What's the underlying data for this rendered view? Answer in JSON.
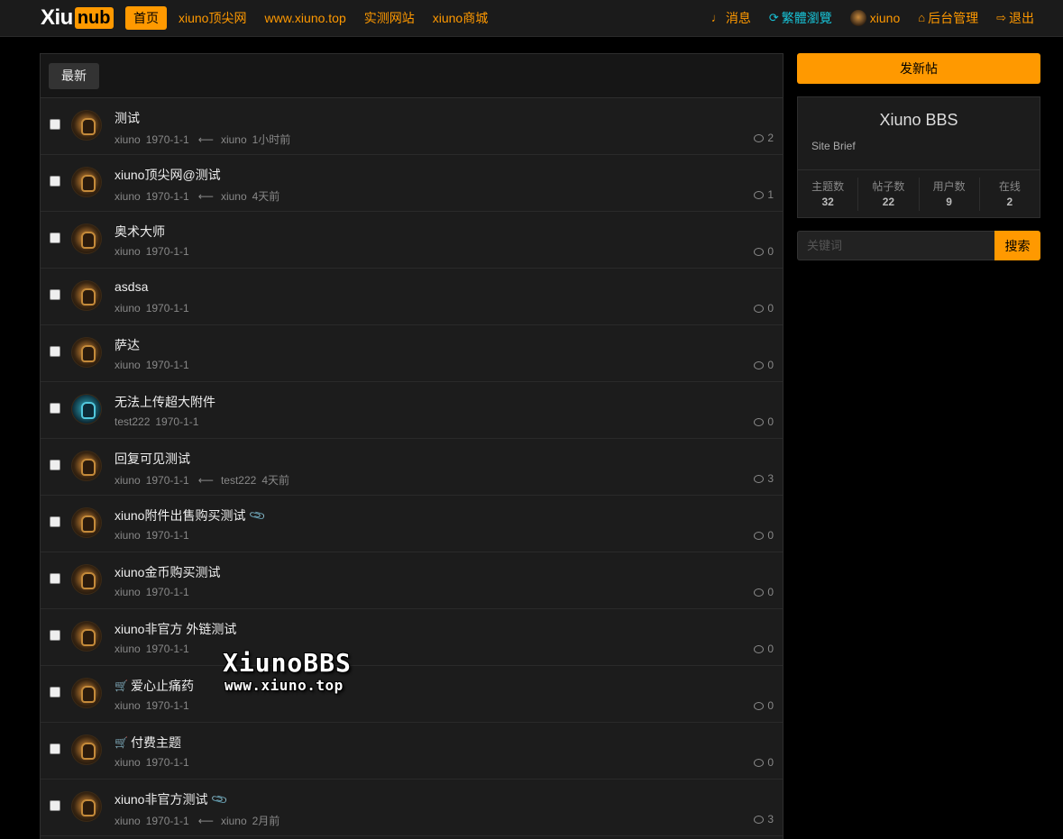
{
  "logo": {
    "part1": "Xiu",
    "part2": "nub"
  },
  "nav": {
    "left": [
      "首页",
      "xiuno顶尖网",
      "www.xiuno.top",
      "实测网站",
      "xiuno商城"
    ],
    "right": [
      {
        "icon": "bell-icon",
        "glyph": "🔔",
        "label": "消息"
      },
      {
        "icon": "refresh-icon",
        "glyph": "⟳",
        "label": "繁體瀏覽"
      },
      {
        "icon": "user-avatar",
        "glyph": "",
        "label": "xiuno"
      },
      {
        "icon": "home-icon",
        "glyph": "⌂",
        "label": "后台管理"
      },
      {
        "icon": "logout-icon",
        "glyph": "⇥",
        "label": "退出"
      }
    ]
  },
  "tabs": {
    "latest": "最新"
  },
  "threads": [
    {
      "title": "测试",
      "author": "xiuno",
      "date": "1970-1-1",
      "last_user": "xiuno",
      "last_time": "1小时前",
      "replies": "2",
      "avatar": "orange",
      "prefix": "",
      "attach": false
    },
    {
      "title": "xiuno顶尖网@测试",
      "author": "xiuno",
      "date": "1970-1-1",
      "last_user": "xiuno",
      "last_time": "4天前",
      "replies": "1",
      "avatar": "orange",
      "prefix": "",
      "attach": false
    },
    {
      "title": "奥术大师",
      "author": "xiuno",
      "date": "1970-1-1",
      "last_user": "",
      "last_time": "",
      "replies": "0",
      "avatar": "orange",
      "prefix": "",
      "attach": false
    },
    {
      "title": "asdsa",
      "author": "xiuno",
      "date": "1970-1-1",
      "last_user": "",
      "last_time": "",
      "replies": "0",
      "avatar": "orange",
      "prefix": "",
      "attach": false
    },
    {
      "title": "萨达",
      "author": "xiuno",
      "date": "1970-1-1",
      "last_user": "",
      "last_time": "",
      "replies": "0",
      "avatar": "orange",
      "prefix": "",
      "attach": false
    },
    {
      "title": "无法上传超大附件",
      "author": "test222",
      "date": "1970-1-1",
      "last_user": "",
      "last_time": "",
      "replies": "0",
      "avatar": "blue",
      "prefix": "",
      "attach": false
    },
    {
      "title": "回复可见测试",
      "author": "xiuno",
      "date": "1970-1-1",
      "last_user": "test222",
      "last_time": "4天前",
      "replies": "3",
      "avatar": "orange",
      "prefix": "",
      "attach": false
    },
    {
      "title": "xiuno附件出售购买测试",
      "author": "xiuno",
      "date": "1970-1-1",
      "last_user": "",
      "last_time": "",
      "replies": "0",
      "avatar": "orange",
      "prefix": "",
      "attach": true
    },
    {
      "title": "xiuno金币购买测试",
      "author": "xiuno",
      "date": "1970-1-1",
      "last_user": "",
      "last_time": "",
      "replies": "0",
      "avatar": "orange",
      "prefix": "",
      "attach": false
    },
    {
      "title": "xiuno非官方 外链测试",
      "author": "xiuno",
      "date": "1970-1-1",
      "last_user": "",
      "last_time": "",
      "replies": "0",
      "avatar": "orange",
      "prefix": "",
      "attach": false
    },
    {
      "title": "爱心止痛药",
      "author": "xiuno",
      "date": "1970-1-1",
      "last_user": "",
      "last_time": "",
      "replies": "0",
      "avatar": "orange",
      "prefix": "cart",
      "attach": false
    },
    {
      "title": "付费主题",
      "author": "xiuno",
      "date": "1970-1-1",
      "last_user": "",
      "last_time": "",
      "replies": "0",
      "avatar": "orange",
      "prefix": "cart",
      "attach": false
    },
    {
      "title": "xiuno非官方测试",
      "author": "xiuno",
      "date": "1970-1-1",
      "last_user": "xiuno",
      "last_time": "2月前",
      "replies": "3",
      "avatar": "orange",
      "prefix": "",
      "attach": true
    }
  ],
  "watermark": {
    "line1": "XiunoBBS",
    "line2": "www.xiuno.top"
  },
  "sidebar": {
    "post_button": "发新帖",
    "site_name": "Xiuno BBS",
    "site_brief": "Site Brief",
    "stats": [
      {
        "label": "主题数",
        "value": "32"
      },
      {
        "label": "帖子数",
        "value": "22"
      },
      {
        "label": "用户数",
        "value": "9"
      },
      {
        "label": "在线",
        "value": "2"
      }
    ],
    "search_placeholder": "关键词",
    "search_button": "搜索"
  },
  "colors": {
    "accent": "#ff9900",
    "cyan": "#18c2d6",
    "bg": "#000000",
    "panel": "#1c1c1c"
  }
}
